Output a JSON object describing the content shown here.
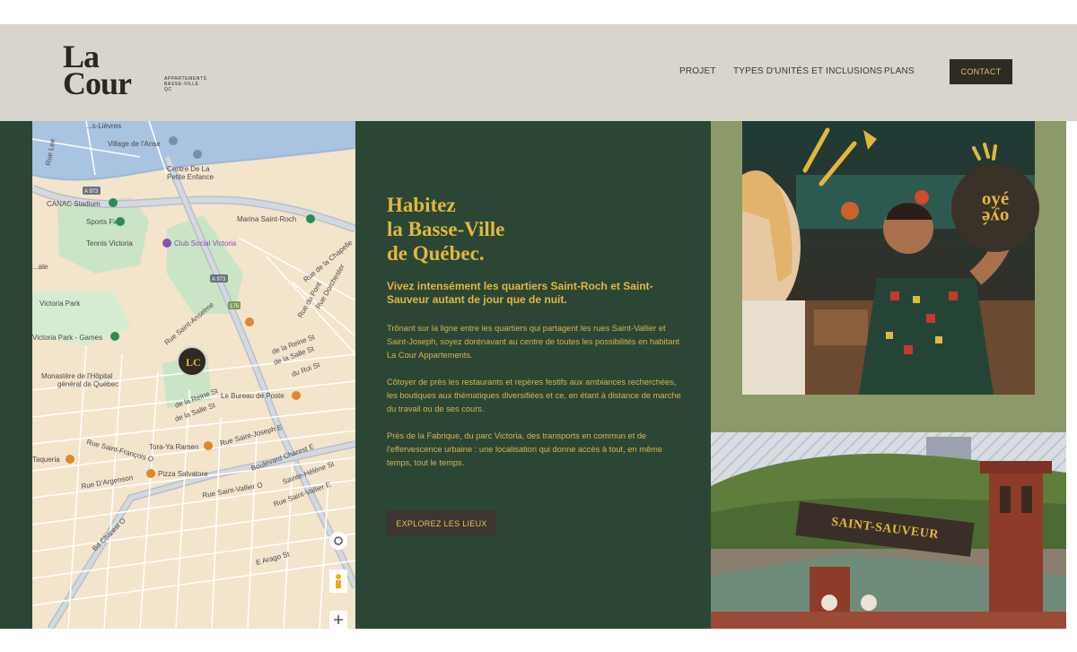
{
  "logo": {
    "title": "La\nCour",
    "subtitle": "APPARTEMENTS\nBASSE-VILLE\nQC"
  },
  "nav": {
    "items": [
      {
        "label": "PROJET"
      },
      {
        "label": "TYPES D'UNITÉS ET INCLUSIONS"
      },
      {
        "label": "PLANS"
      }
    ],
    "contact_label": "CONTACT"
  },
  "hero": {
    "headline": "Habitez\nla Basse-Ville\nde Québec.",
    "subhead": "Vivez intensément les quartiers Saint-Roch et Saint-Sauveur autant de jour que de nuit.",
    "paragraphs": [
      "Trônant sur la ligne entre les quartiers qui partagent les rues Saint-Vallier et Saint-Joseph, soyez dorénavant au centre de toutes les possibilités en habitant La Cour Appartements.",
      "Côtoyer de près les restaurants et repères festifs aux ambiances recherchées, les boutiques aux thématiques diversifiées et ce, en étant à distance de marche du travail ou de ses cours.",
      "Près de la Fabrique, du parc Victoria, des transports en commun et de l'effervescence urbaine : une localisation qui donne accès à tout, en même temps, tout le temps."
    ],
    "cta_label": "EXPLOREZ LES LIEUX"
  },
  "photo_badge": {
    "top": "oyé",
    "bottom": "oyé"
  },
  "neighbourhood_label": "SAINT-SAUVEUR",
  "map": {
    "marker_text": "LC",
    "labels": {
      "village": "Village de l'Anse",
      "centre": "Centre De La",
      "centre2": "Petite Enfance",
      "canac": "CANAC Stadium",
      "sports": "Sports Field",
      "tennis": "Tennis Victoria",
      "club": "Club Social Victoria",
      "marina": "Marina Saint-Roch",
      "park": "Victoria Park",
      "park_games": "Victoria Park - Games",
      "hopital": "Monastère de l'Hôpital",
      "hopital2": "général de Québec",
      "poste": "Le Bureau de Poste",
      "tora": "Tora-Ya Ramen",
      "pizza": "Pizza Salvatore",
      "taqueria": "Taqueria",
      "st_anselme": "Rue Saint-Anselme",
      "de_la_reine": "de la Reine St",
      "de_la_salle": "de la Salle St",
      "du_roi": "du Roi St",
      "de_la_reine2": "de la Reine St",
      "de_la_salle2": "de la Salle St",
      "st_joseph": "Rue Saint-Joseph E",
      "st_francois": "Rue Saint-François O",
      "dargenson": "Rue D'Argenson",
      "charest": "Boulevard Charest E",
      "bd_charest": "Bd Charest O",
      "st_vallier": "Rue Saint-Vallier E",
      "st_vallier_o": "Rue Saint-Vallier O",
      "helene": "Sainte-Hélène St",
      "rue_lee": "Rue Lee",
      "levres": "...s-Lièvres",
      "arago": "E Arago St",
      "du_pont": "Rue du Pont",
      "dorchester": "Rue Dorchester",
      "de_la_chapelle": "Rue de la Chapelle",
      "a973": "A 973",
      "a973b": "A 973",
      "r175": "175",
      "vle": "...ale"
    }
  },
  "colors": {
    "green": "#2c4636",
    "gold": "#e1b83d",
    "header": "#d9d4cc",
    "olive": "#8c9968",
    "dark": "#2e2a25"
  }
}
